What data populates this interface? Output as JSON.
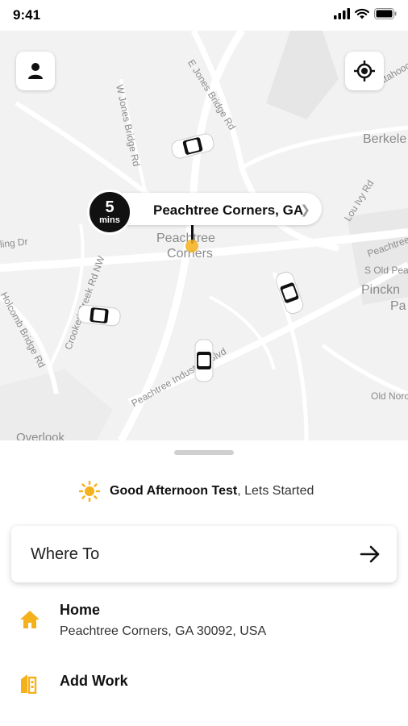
{
  "status_bar": {
    "time": "9:41"
  },
  "map": {
    "streets": [
      "W Jones Bridge Rd",
      "E Jones Bridge Rd",
      "Lou Ivy Rd",
      "Crooked Creek Rd NW",
      "Holcomb Bridge Rd",
      "Peachtree Industrial Blvd",
      "Peachtree",
      "S Old Peachtree",
      "Old Norcross",
      "ling Dr",
      "attahoochee",
      "Overlook"
    ],
    "areas": [
      "Peachtree Corners",
      "Berkeley",
      "Pinckneyville Park"
    ],
    "area_lines": {
      "peachtree": [
        "Peachtree",
        "Corners"
      ],
      "berkeley": "Berkele",
      "pinckney": [
        "Pinckn",
        "Pa"
      ]
    }
  },
  "pickup": {
    "eta_value": "5",
    "eta_unit": "mins",
    "location": "Peachtree Corners, GA",
    "accent_color": "#f5b11c"
  },
  "greeting": {
    "bold": "Good Afternoon Test",
    "rest": ", Lets Started"
  },
  "search": {
    "placeholder": "Where To"
  },
  "saved_places": [
    {
      "title": "Home",
      "address": "Peachtree Corners, GA 30092, USA",
      "icon": "home-icon"
    },
    {
      "title": "Add Work",
      "icon": "work-icon"
    }
  ],
  "colors": {
    "accent": "#f5b11c",
    "map_bg": "#f2f2f2",
    "dark": "#111111"
  }
}
